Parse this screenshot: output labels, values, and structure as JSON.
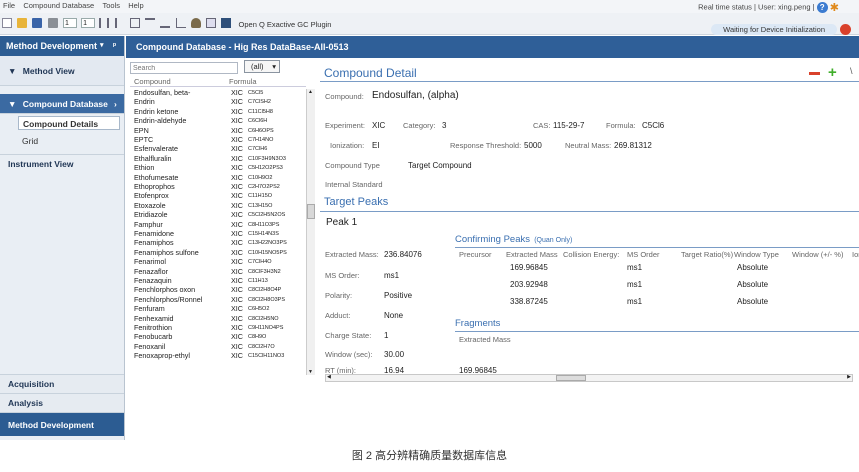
{
  "menu": {
    "items": [
      "File",
      "Compound Database",
      "Tools",
      "Help"
    ]
  },
  "toolbar": {
    "plugin_label": "Open Q Exactive GC Plugin",
    "spin1": "1",
    "spin2": "1"
  },
  "status": {
    "text": "Real time status | User: xing.peng |",
    "waiting": "Waiting for Device Initialization"
  },
  "nav": {
    "header": "Method Development",
    "method_view": "Method View",
    "compound_db": "Compound Database",
    "compound_details": "Compound Details",
    "grid": "Grid",
    "instrument_view": "Instrument View",
    "acquisition": "Acquisition",
    "analysis": "Analysis",
    "method_dev": "Method Development"
  },
  "main": {
    "title": "Compound Database - Hig Res DataBase-All-0513"
  },
  "list": {
    "search_placeholder": "Search",
    "filter": "(all)",
    "col_compound": "Compound",
    "col_formula": "Formula",
    "rows": [
      {
        "name": "Endosulfan, beta-",
        "type": "XIC",
        "formula": "C5Cl5"
      },
      {
        "name": "Endrin",
        "type": "XIC",
        "formula": "C7ClSH2"
      },
      {
        "name": "Endrin ketone",
        "type": "XIC",
        "formula": "C11Cl5H8"
      },
      {
        "name": "Endrin-aldehyde",
        "type": "XIC",
        "formula": "C6Cl6H"
      },
      {
        "name": "EPN",
        "type": "XIC",
        "formula": "C6H6OPS"
      },
      {
        "name": "EPTC",
        "type": "XIC",
        "formula": "C7H14NO"
      },
      {
        "name": "Esfenvalerate",
        "type": "XIC",
        "formula": "C7ClH6"
      },
      {
        "name": "Ethalfluralin",
        "type": "XIC",
        "formula": "C10F3H9N3O3"
      },
      {
        "name": "Ethion",
        "type": "XIC",
        "formula": "C5H12O2PS3"
      },
      {
        "name": "Ethofumesate",
        "type": "XIC",
        "formula": "C10H9O2"
      },
      {
        "name": "Ethoprophos",
        "type": "XIC",
        "formula": "C2H7O2PS2"
      },
      {
        "name": "Etofenprox",
        "type": "XIC",
        "formula": "C11H15O"
      },
      {
        "name": "Etoxazole",
        "type": "XIC",
        "formula": "C13H15O"
      },
      {
        "name": "Etridiazole",
        "type": "XIC",
        "formula": "C5Cl2H5N2OS"
      },
      {
        "name": "Famphur",
        "type": "XIC",
        "formula": "C8H11O3PS"
      },
      {
        "name": "Fenamidone",
        "type": "XIC",
        "formula": "C15H14N3S"
      },
      {
        "name": "Fenamiphos",
        "type": "XIC",
        "formula": "C13H22NO3PS"
      },
      {
        "name": "Fenamiphos sulfone",
        "type": "XIC",
        "formula": "C10H15NO5PS"
      },
      {
        "name": "Fenarimol",
        "type": "XIC",
        "formula": "C7ClH4O"
      },
      {
        "name": "Fenazaflor",
        "type": "XIC",
        "formula": "C8ClF3H3N2"
      },
      {
        "name": "Fenazaquin",
        "type": "XIC",
        "formula": "C11H13"
      },
      {
        "name": "Fenchlorphos oxon",
        "type": "XIC",
        "formula": "C8Cl2H8O4P"
      },
      {
        "name": "Fenchlorphos/Ronnel",
        "type": "XIC",
        "formula": "C8Cl2H8O3PS"
      },
      {
        "name": "Fenfuram",
        "type": "XIC",
        "formula": "C6H5O2"
      },
      {
        "name": "Fenhexamid",
        "type": "XIC",
        "formula": "C8Cl2H5NO"
      },
      {
        "name": "Fenitrothion",
        "type": "XIC",
        "formula": "C9H11NO4PS"
      },
      {
        "name": "Fenobucarb",
        "type": "XIC",
        "formula": "C8H9O"
      },
      {
        "name": "Fenoxanil",
        "type": "XIC",
        "formula": "C8Cl2H7O"
      },
      {
        "name": "Fenoxaprop-ethyl",
        "type": "XIC",
        "formula": "C15ClH11NO3"
      }
    ]
  },
  "detail": {
    "title": "Compound Detail",
    "compound_label": "Compound:",
    "compound_value": "Endosulfan, (alpha)",
    "experiment_label": "Experiment:",
    "experiment_value": "XIC",
    "category_label": "Category:",
    "category_value": "3",
    "cas_label": "CAS:",
    "cas_value": "115-29-7",
    "formula_label": "Formula:",
    "formula_value": "C5Cl6",
    "ionization_label": "Ionization:",
    "ionization_value": "EI",
    "resp_label": "Response Threshold:",
    "resp_value": "5000",
    "neutral_label": "Neutral Mass:",
    "neutral_value": "269.81312",
    "ctype_label": "Compound Type",
    "ctype_value": "Target Compound",
    "internal_std": "Internal Standard",
    "target_peaks": "Target Peaks",
    "peak1": "Peak 1",
    "confirming": "Confirming Peaks",
    "quan_only": "(Quan Only)",
    "conf_headers": [
      "Precursor",
      "Extracted Mass",
      "Collision Energy:",
      "MS Order",
      "Target Ratio(%)",
      "Window Type",
      "Window (+/- %)",
      "Ion"
    ],
    "conf_rows": [
      {
        "mass": "169.96845",
        "order": "ms1",
        "wtype": "Absolute"
      },
      {
        "mass": "203.92948",
        "order": "ms1",
        "wtype": "Absolute"
      },
      {
        "mass": "338.87245",
        "order": "ms1",
        "wtype": "Absolute"
      }
    ],
    "em_label": "Extracted Mass:",
    "em_value": "236.84076",
    "msorder_label": "MS Order:",
    "msorder_value": "ms1",
    "polarity_label": "Polarity:",
    "polarity_value": "Positive",
    "adduct_label": "Adduct:",
    "adduct_value": "None",
    "charge_label": "Charge State:",
    "charge_value": "1",
    "fragments": "Fragments",
    "frag_header": "Extracted Mass",
    "frag_value": "169.96845",
    "window_label": "Window (sec):",
    "window_value": "30.00",
    "rt_label": "RT (min):",
    "rt_value": "16.94"
  },
  "caption": "图 2 高分辨精确质量数据库信息",
  "colors": {
    "nav_header": "#2c5c92",
    "accent_blue": "#3a6fb0",
    "remove_red": "#d9412b",
    "add_green": "#3fae2a"
  }
}
